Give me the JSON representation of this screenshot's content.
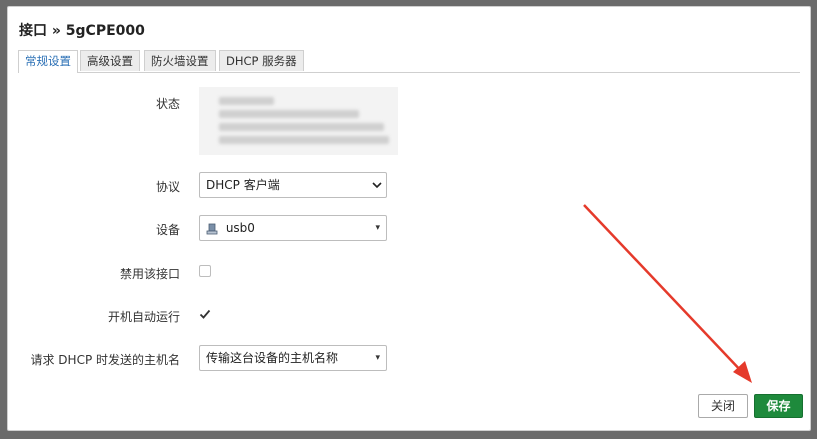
{
  "modal": {
    "title": "接口 » 5gCPE000"
  },
  "tabs": [
    {
      "label": "常规设置",
      "active": true
    },
    {
      "label": "高级设置",
      "active": false
    },
    {
      "label": "防火墙设置",
      "active": false
    },
    {
      "label": "DHCP 服务器",
      "active": false
    }
  ],
  "form": {
    "status_label": "状态",
    "protocol_label": "协议",
    "protocol_value": "DHCP 客户端",
    "device_label": "设备",
    "device_value": "usb0",
    "disable_label": "禁用该接口",
    "disable_checked": false,
    "autostart_label": "开机自动运行",
    "autostart_checked": true,
    "hostname_label": "请求 DHCP 时发送的主机名",
    "hostname_value": "传输这台设备的主机名称"
  },
  "footer": {
    "close_label": "关闭",
    "save_label": "保存"
  },
  "colors": {
    "tab_active_text": "#2a6fb5",
    "save_button": "#1e8a3c",
    "annotation_arrow": "#e53a2b"
  }
}
